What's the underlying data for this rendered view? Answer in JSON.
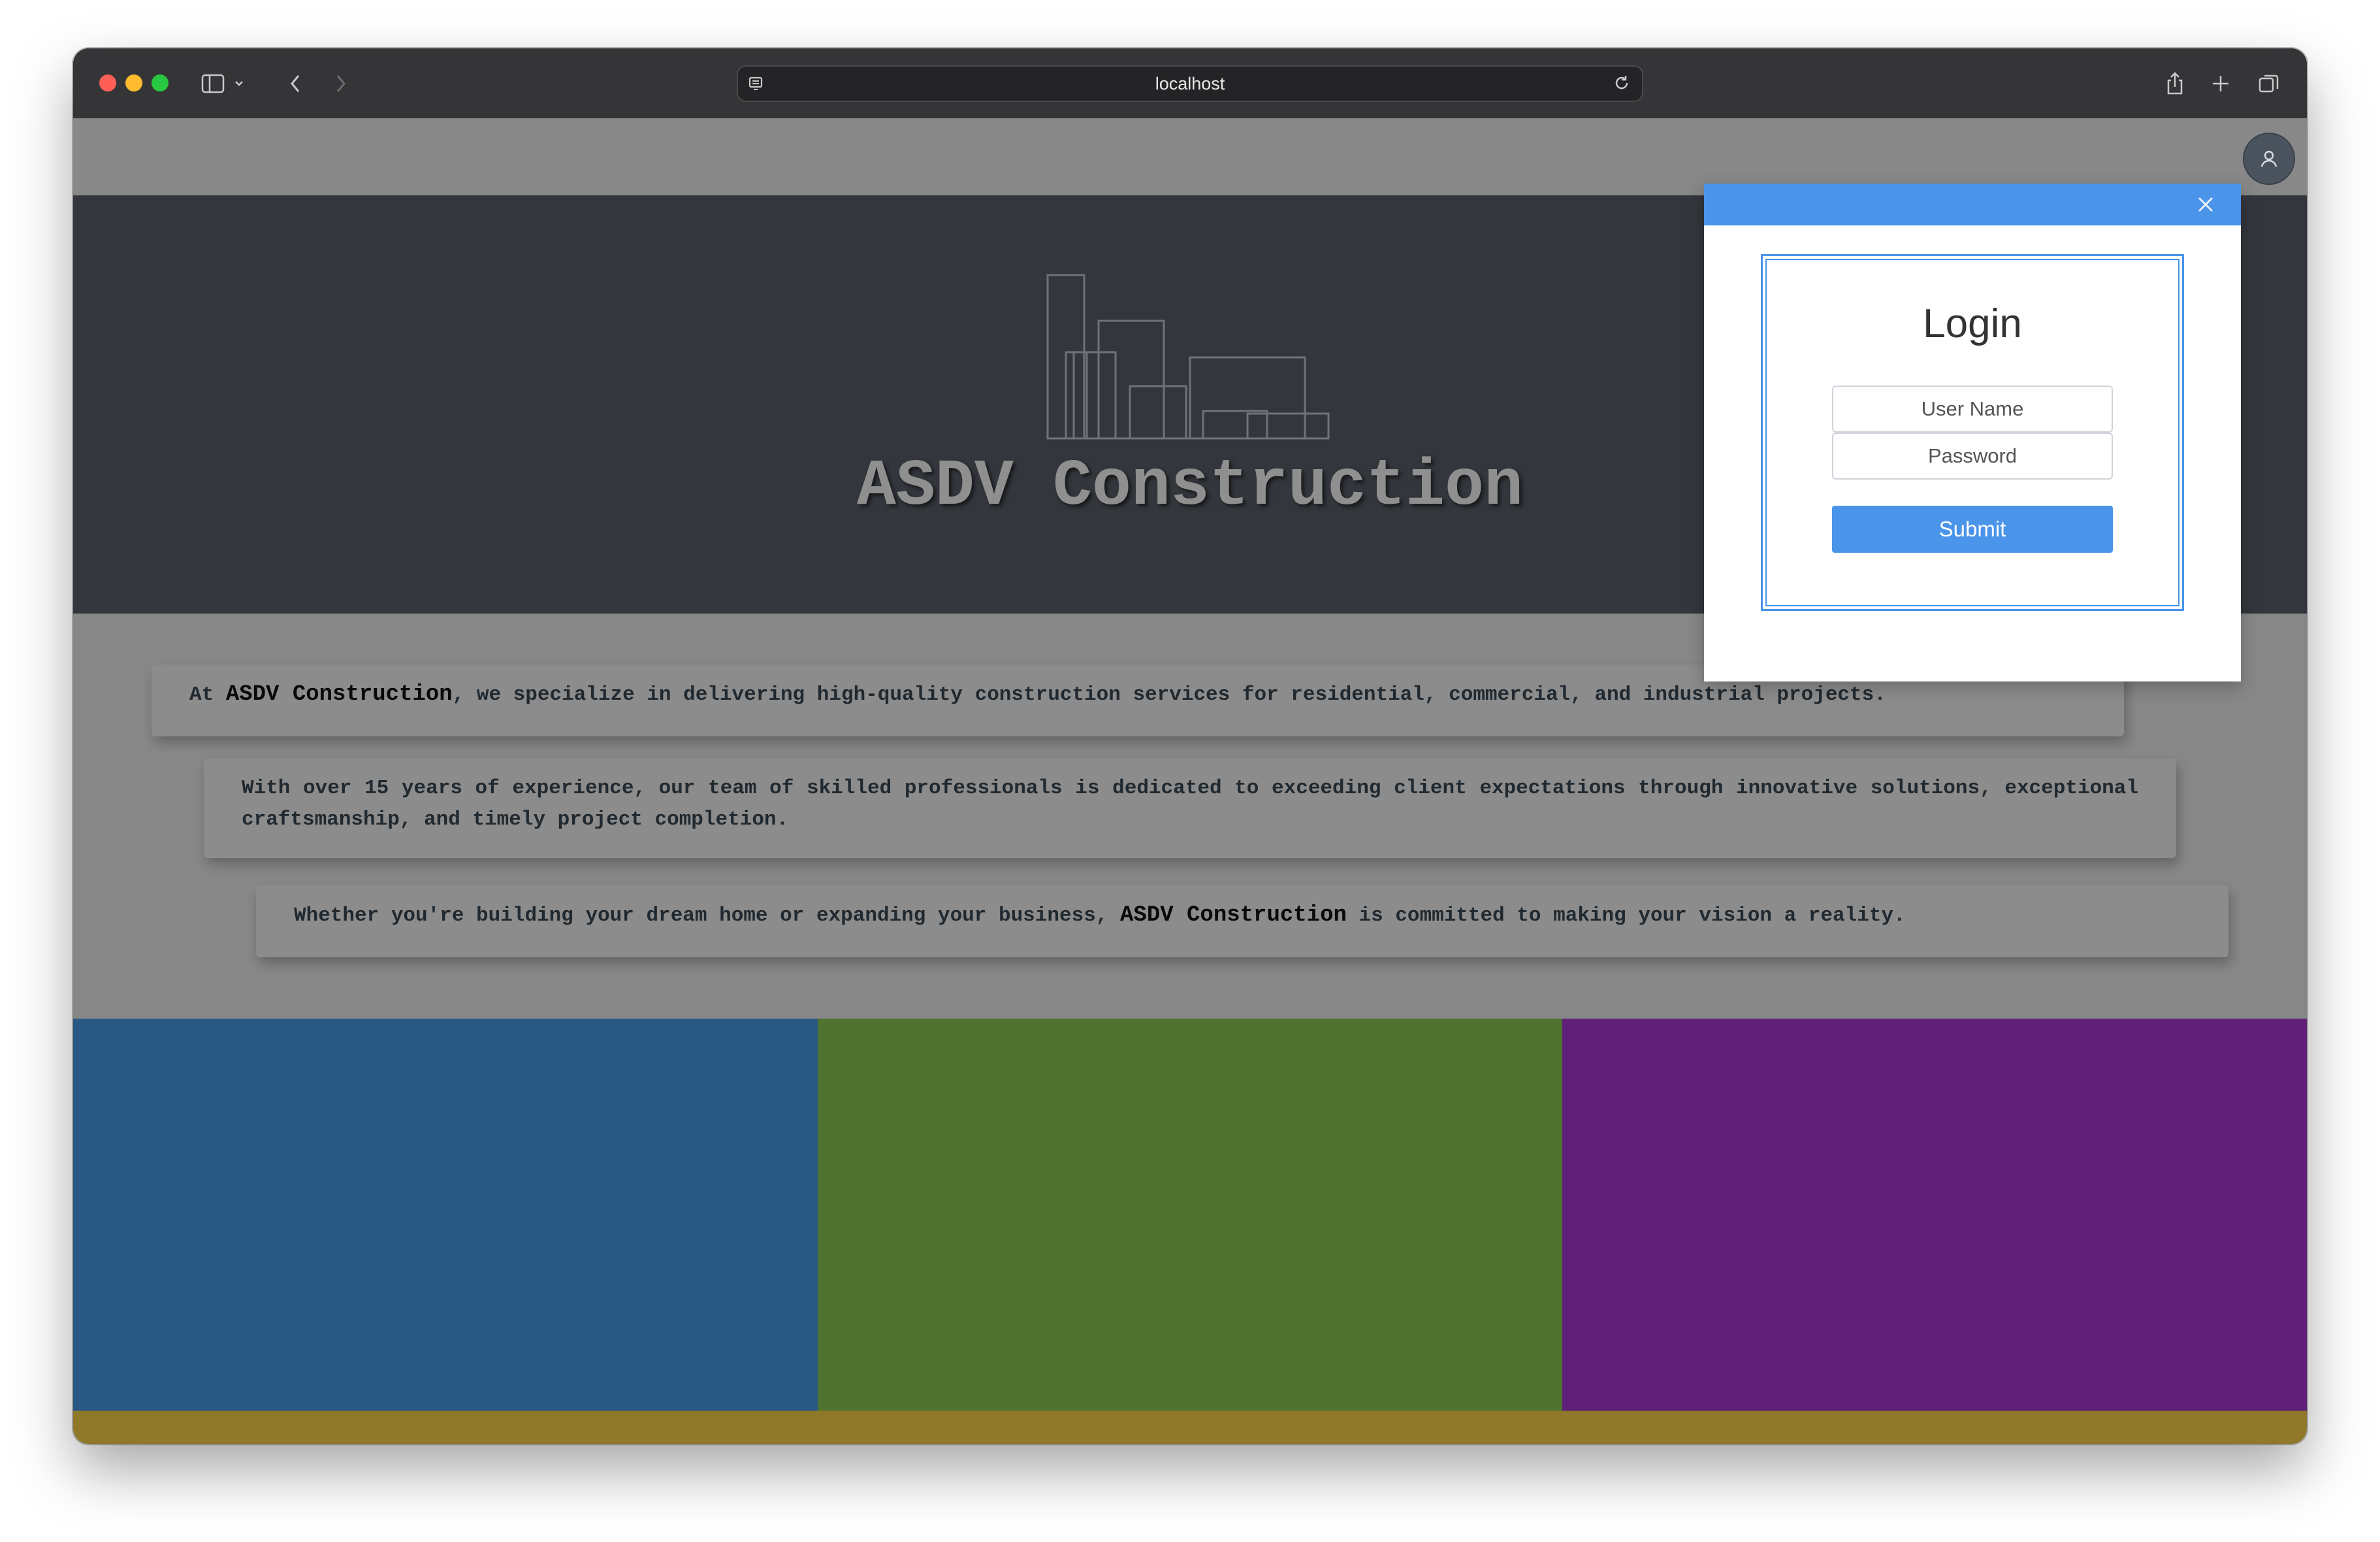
{
  "browser": {
    "url": "localhost",
    "colors": {
      "titlebar": "#353537",
      "address_bar": "#242426"
    }
  },
  "site": {
    "title": "ASDV Construction",
    "cards": [
      {
        "prefix": "At ",
        "brand": "ASDV Construction",
        "suffix": ", we specialize in delivering high-quality construction services for residential, commercial, and industrial projects."
      },
      {
        "text": "With over 15 years of experience, our team of skilled professionals is dedicated to exceeding client expectations through innovative solutions, exceptional craftsmanship, and timely project completion."
      },
      {
        "prefix": "Whether you're building your dream home or expanding your business, ",
        "brand": "ASDV Construction",
        "suffix": " is committed to making your vision a reality."
      }
    ],
    "colors": {
      "hero": "#5b616b",
      "tile_blue": "#4a9fe8",
      "tile_green": "#8fce59",
      "tile_purple": "#ab3ad9",
      "footer": "#ffd64a"
    }
  },
  "login_modal": {
    "title": "Login",
    "username_placeholder": "User Name",
    "password_placeholder": "Password",
    "submit_label": "Submit",
    "accent": "#4a94e9"
  },
  "icons": {
    "sidebar": "sidebar-icon",
    "back": "chevron-left-icon",
    "forward": "chevron-right-icon",
    "share": "share-icon",
    "new_tab": "plus-icon",
    "tabs": "tabs-icon",
    "reload": "reload-icon",
    "user": "user-icon",
    "close": "close-icon"
  }
}
